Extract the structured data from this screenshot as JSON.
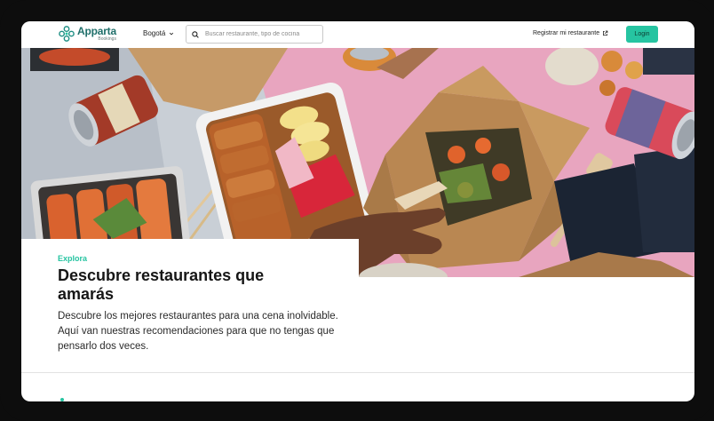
{
  "header": {
    "logo_name": "Apparta",
    "logo_sub": "Bookings",
    "city": "Bogotá",
    "search_placeholder": "Buscar restaurante, tipo de cocina",
    "register_label": "Registrar mi restaurante",
    "login_label": "Login"
  },
  "hero": {
    "eyebrow": "Explora",
    "title": "Descubre restaurantes que amarás",
    "description": "Descubre los mejores restaurantes para una cena inolvidable. Aquí van nuestras recomendaciones para que no tengas que pensarlo dos veces."
  },
  "colors": {
    "accent": "#26c4a1",
    "brand_dark": "#1f6f6a",
    "hero_pink": "#e9a9c0"
  },
  "icons": {
    "logo": "apparta-logo-mark",
    "search": "search-icon",
    "city_dropdown": "chevron-down-icon",
    "external": "external-link-icon"
  }
}
